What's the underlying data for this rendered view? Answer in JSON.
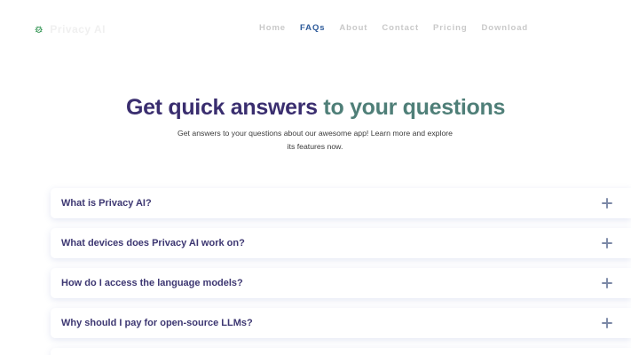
{
  "brand": {
    "name": "Privacy AI",
    "icon_name": "bug-icon"
  },
  "nav": {
    "items": [
      {
        "label": "Home",
        "active": false
      },
      {
        "label": "FAQs",
        "active": true
      },
      {
        "label": "About",
        "active": false
      },
      {
        "label": "Contact",
        "active": false
      },
      {
        "label": "Pricing",
        "active": false
      },
      {
        "label": "Download",
        "active": false
      }
    ]
  },
  "hero": {
    "title_part1": "Get quick answers",
    "title_part2": "to your questions",
    "subtitle": "Get answers to your questions about our awesome app! Learn more and explore its features now."
  },
  "faq": {
    "items": [
      {
        "question": "What is Privacy AI?",
        "icon": "plus-icon"
      },
      {
        "question": "What devices does Privacy AI work on?",
        "icon": "plus-icon"
      },
      {
        "question": "How do I access the language models?",
        "icon": "plus-icon"
      },
      {
        "question": "Why should I pay for open-source LLMs?",
        "icon": "plus-icon"
      }
    ]
  },
  "colors": {
    "title_dark": "#3a2e6f",
    "title_accent": "#4f7f78",
    "nav_active": "#2e5b9a",
    "question_text": "#3d3772",
    "plus_icon": "#7b88a6"
  }
}
